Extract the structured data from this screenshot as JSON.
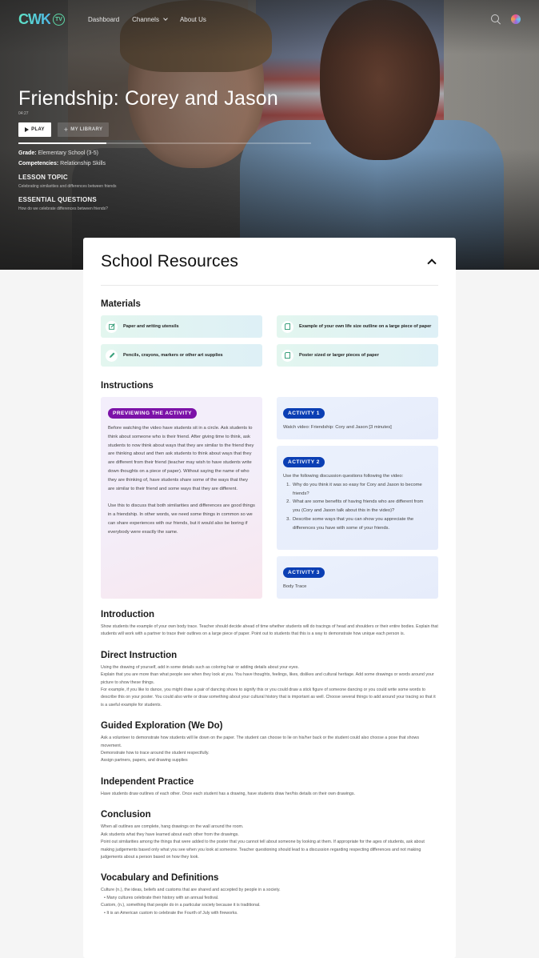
{
  "nav": {
    "logo_text": "CWK",
    "logo_badge": "TV",
    "links": [
      {
        "label": "Dashboard"
      },
      {
        "label": "Channels",
        "has_dropdown": true
      },
      {
        "label": "About Us"
      }
    ],
    "icons": {
      "search": "search-icon",
      "avatar": "user-avatar"
    }
  },
  "hero": {
    "title": "Friendship: Corey and Jason",
    "duration": "04:27",
    "play_label": "PLAY",
    "library_label": "MY LIBRARY",
    "progress_fraction": 0.3,
    "grade_label": "Grade:",
    "grade_value": "Elementary School (3-5)",
    "competencies_label": "Competencies:",
    "competencies_value": "Relationship Skills",
    "lesson_topic_heading": "LESSON TOPIC",
    "lesson_topic": "Celebrating similarities and differences between friends",
    "essential_questions_heading": "ESSENTIAL QUESTIONS",
    "essential_questions": "How do we celebrate differences between friends?"
  },
  "resources": {
    "title": "School Resources",
    "materials_title": "Materials",
    "materials": [
      {
        "icon": "edit-icon",
        "label": "Paper and writing utensils"
      },
      {
        "icon": "page-icon",
        "label": "Example of your own life size outline on a large piece of paper"
      },
      {
        "icon": "pencil-icon",
        "label": "Pencils, crayons, markers or other art supplies"
      },
      {
        "icon": "page-icon",
        "label": "Poster sized or larger pieces of paper"
      }
    ],
    "instructions_title": "Instructions",
    "preview": {
      "badge": "PREVIEWING THE ACTIVITY",
      "paragraphs": [
        "Before watching the video have students sit in a circle. Ask students to think about someone who is their friend. After giving time to think, ask students to now think about ways that they are similar to the friend they are thinking about and then ask students to think about ways that they are different from their friend (teacher may wish to have students write down thoughts on a piece of paper). Without saying the name of who they are thinking of, have students share some of the ways that they are similar to their friend and some ways that they are different.",
        "Use this to discuss that both similarities and differences are good things in a friendship. In other words, we need some things in common so we can share experiences with our friends, but it would also be boring if everybody were exactly the same."
      ]
    },
    "activities": [
      {
        "badge": "ACTIVITY 1",
        "text": "Watch video: Friendship: Cory and Jason [3 minutes]"
      },
      {
        "badge": "ACTIVITY 2",
        "text": "Use the following discussion questions following the video:",
        "list": [
          "Why do you think it was so easy for Cory and Jason to become friends?",
          "What are some benefits of having friends who are different from you (Cory and Jason talk about this in the video)?",
          "Describe some ways that you can show you appreciate the differences you have with some of your friends."
        ]
      },
      {
        "badge": "ACTIVITY 3",
        "text": "Body Trace"
      }
    ],
    "sections": [
      {
        "title": "Introduction",
        "lines": [
          "Show students the example of your own body trace. Teacher should decide ahead of time whether students will do tracings of head and shoulders or their entire bodies. Explain that students will work with a partner to trace their outlines on a large piece of paper. Point out to students that this is a way to demonstrate how unique each person is."
        ]
      },
      {
        "title": "Direct Instruction",
        "lines": [
          "Using the drawing of yourself, add in some details such as coloring hair or adding details about your eyes.",
          "Explain that you are more than what people see when they look at you. You have thoughts, feelings, likes, dislikes and cultural heritage. Add some drawings or words around your picture to show these things.",
          "For example, if you like to dance, you might draw a pair of dancing shoes to signify this or you could draw a stick figure of someone dancing or you could write some words to describe this on your poster. You could also write or draw something about your cultural history that is important as well. Choose several things to add around your tracing so that it is a useful example for students."
        ]
      },
      {
        "title": "Guided Exploration (We Do)",
        "lines": [
          "Ask a volunteer to demonstrate how students will lie down on the paper. The student can choose to lie on his/her back or the student could also choose a pose that shows movement.",
          "Demonstrate how to trace around the student respectfully.",
          "Assign partners, papers, and drawing supplies"
        ]
      },
      {
        "title": "Independent Practice",
        "lines": [
          "Have students draw outlines of each other. Once each student has a drawing, have students draw her/his details on their own drawings."
        ]
      },
      {
        "title": "Conclusion",
        "lines": [
          "When all outlines are complete, hang drawings on the wall around the room.",
          "Ask students what they have learned about each other from the drawings.",
          "Point out similarities among the things that were added to the poster that you cannot tell about someone by looking at them. If appropriate for the ages of students, ask about making judgements based only what you see when you look at someone. Teacher questioning should lead to a discussion regarding respecting differences and not making judgements about a person based on how they look."
        ]
      },
      {
        "title": "Vocabulary and Definitions",
        "lines": [
          "Culture (n.), the ideas, beliefs and customs that are shared and accepted by people in a society."
        ],
        "bullets_after": {
          "0": "Many cultures celebrate their history with an annual festival."
        },
        "extra_lines": [
          "Custom, (n.), something that people do in a particular society because it is traditional."
        ],
        "extra_bullets": [
          "It is an American custom to celebrate the Fourth of July with fireworks."
        ]
      }
    ]
  },
  "colors": {
    "preview_badge": "#7c12a8",
    "activity_badge": "#0b3fb4",
    "material_icon": "#3aa07c",
    "logo_gradient_start": "#5fe3c6",
    "logo_gradient_end": "#4fb8e8"
  }
}
